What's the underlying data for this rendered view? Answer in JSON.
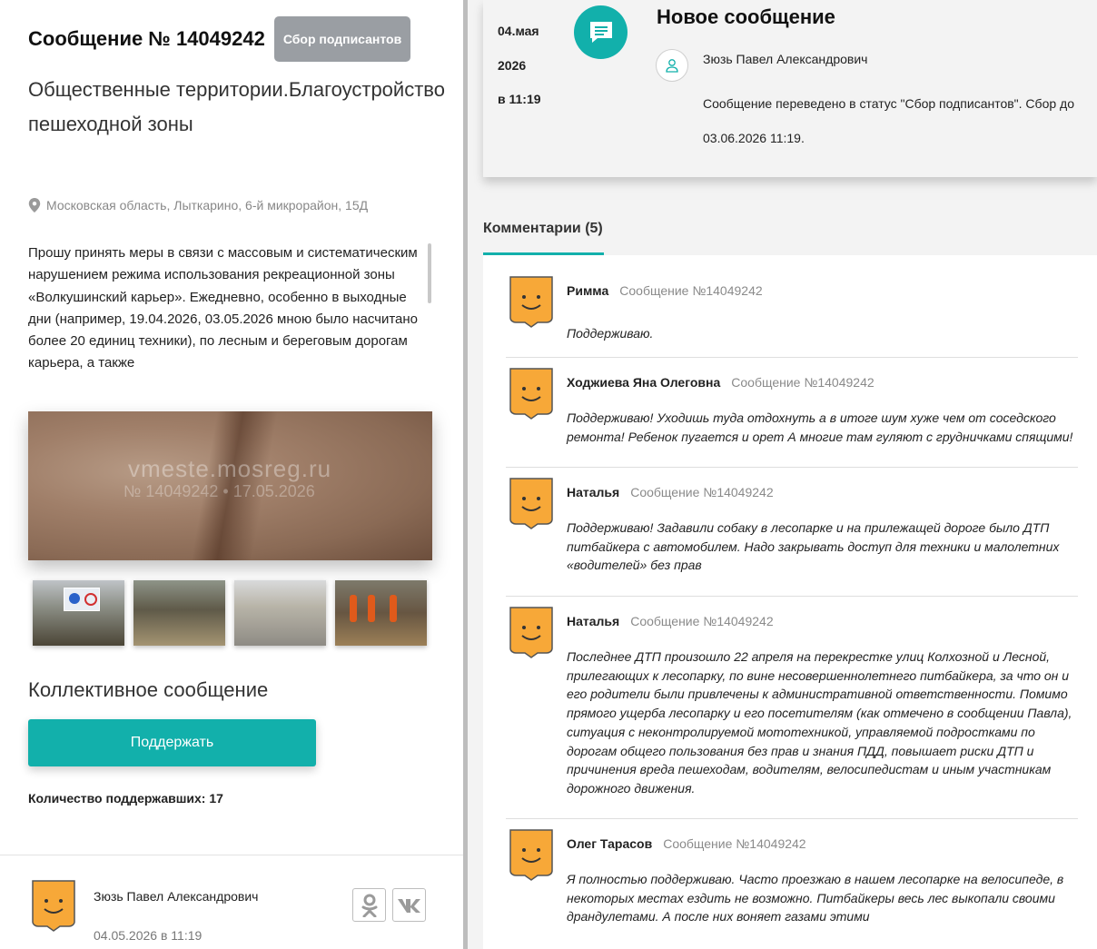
{
  "message": {
    "title": "Сообщение № 14049242",
    "status": "Сбор подписантов",
    "category": "Общественные территории.Благоустройство пешеходной зоны",
    "address": "Московская область, Лыткарино, 6-й микрорайон, 15Д",
    "description": "Прошу принять меры в связи с массовым и систематическим нарушением режима использования рекреационной зоны «Волкушинский карьер». Ежедневно, особенно в выходные дни (например, 19.04.2026, 03.05.2026 мною было насчитано более 20 единиц техники), по лесным и береговым дорогам карьера, а также",
    "photo_watermark": "vmeste.mosreg.ru",
    "photo_watermark_line2": "№ 14049242 • 17.05.2026",
    "collective_label": "Коллективное сообщение",
    "support_button": "Поддержать",
    "support_count": "Количество поддержавших: 17"
  },
  "author": {
    "name": "Зюзь Павел Александрович",
    "date": "04.05.2026 в 11:19",
    "share": [
      "odnoklassniki-icon",
      "vk-icon"
    ]
  },
  "event": {
    "date_day": "04.мая",
    "date_year": "2026",
    "date_time": "в 11:19",
    "title": "Новое сообщение",
    "user": "Зюзь Павел Александрович",
    "text": "Сообщение переведено в статус \"Сбор подписантов\". Сбор до 03.06.2026 11:19."
  },
  "comments_tab": "Комментарии (5)",
  "comments": [
    {
      "name": "Римма",
      "ref": "Сообщение №14049242",
      "text": "Поддерживаю."
    },
    {
      "name": "Ходжиева Яна Олеговна",
      "ref": "Сообщение №14049242",
      "text": "Поддерживаю! Уходишь туда отдохнуть а в итоге шум хуже чем от соседского ремонта! Ребенок пугается и орет А многие там гуляют с грудничками спящими!"
    },
    {
      "name": "Наталья",
      "ref": "Сообщение №14049242",
      "text": "Поддерживаю! Задавили собаку в лесопарке и на прилежащей дороге было ДТП питбайкера с автомобилем. Надо закрывать доступ для техники и малолетних «водителей» без прав"
    },
    {
      "name": "Наталья",
      "ref": "Сообщение №14049242",
      "text": "Последнее ДТП произошло 22 апреля на перекрестке улиц Колхозной и Лесной, прилегающих к лесопарку, по вине несовершеннолетнего питбайкера, за что он и его родители были привлечены к административной ответственности. Помимо прямого ущерба лесопарку и его посетителям (как отмечено в сообщении Павла), ситуация с неконтролируемой мототехникой, управляемой подростками по дорогам общего пользования без прав и знания ПДД, повышает риски ДТП и причинения вреда пешеходам, водителям, велосипедистам и иным участникам дорожного движения."
    },
    {
      "name": "Олег Тарасов",
      "ref": "Сообщение №14049242",
      "text": "Я полностью поддерживаю. Часто проезжаю в нашем лесопарке на велосипеде, в некоторых местах ездить не возможно. Питбайкеры весь лес выкопали своими драндулетами. А после них воняет газами этими"
    }
  ],
  "colors": {
    "accent": "#12b0ab",
    "avatar": "#f7a838",
    "badge": "#9a9ea3"
  }
}
